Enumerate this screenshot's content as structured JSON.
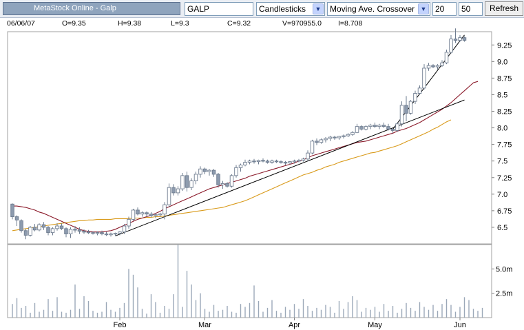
{
  "toolbar": {
    "title": "MetaStock Online - Galp",
    "symbol": "GALP",
    "chart_style": "Candlesticks",
    "indicator": "Moving Ave. Crossover",
    "period_fast": "20",
    "period_slow": "50",
    "refresh_label": "Refresh"
  },
  "info": {
    "date": "06/06/07",
    "open": "O=9.35",
    "high": "H=9.38",
    "low": "L=9.3",
    "close": "C=9.32",
    "volume": "V=970955.0",
    "interest": "I=8.708"
  },
  "colors": {
    "background": "#ffffff",
    "panel_border": "#a0a0a0",
    "candle_up": "#ffffff",
    "candle_down": "#8d9bae",
    "candle_outline": "#6e7c8f",
    "ma_fast": "#8b1a2a",
    "ma_slow": "#d99a1a",
    "trendline": "#000000",
    "volume_bar": "#9ba8b8"
  },
  "chart_data": {
    "type": "candlestick",
    "price_axis": {
      "ticks": [
        "9.25",
        "9.0",
        "8.75",
        "8.5",
        "8.25",
        "8.0",
        "7.75",
        "7.5",
        "7.25",
        "7.0",
        "6.75",
        "6.5"
      ],
      "ylim": [
        6.25,
        9.45
      ]
    },
    "volume_axis": {
      "ticks": [
        "5.0m",
        "2.5m"
      ],
      "ylim": [
        0,
        7500000
      ]
    },
    "x_labels": [
      "Feb",
      "Mar",
      "Apr",
      "May",
      "Jun"
    ],
    "x_label_days": [
      24,
      43,
      63,
      81,
      100
    ],
    "ohlc": [
      [
        6.85,
        6.86,
        6.62,
        6.66
      ],
      [
        6.66,
        6.68,
        6.52,
        6.61
      ],
      [
        6.6,
        6.62,
        6.42,
        6.45
      ],
      [
        6.45,
        6.48,
        6.32,
        6.38
      ],
      [
        6.38,
        6.52,
        6.36,
        6.5
      ],
      [
        6.5,
        6.55,
        6.44,
        6.46
      ],
      [
        6.46,
        6.56,
        6.44,
        6.54
      ],
      [
        6.54,
        6.58,
        6.46,
        6.5
      ],
      [
        6.5,
        6.52,
        6.38,
        6.42
      ],
      [
        6.42,
        6.5,
        6.38,
        6.48
      ],
      [
        6.48,
        6.56,
        6.45,
        6.52
      ],
      [
        6.52,
        6.56,
        6.46,
        6.48
      ],
      [
        6.48,
        6.5,
        6.35,
        6.4
      ],
      [
        6.4,
        6.5,
        6.34,
        6.47
      ],
      [
        6.47,
        6.52,
        6.42,
        6.46
      ],
      [
        6.46,
        6.5,
        6.4,
        6.44
      ],
      [
        6.44,
        6.47,
        6.4,
        6.43
      ],
      [
        6.43,
        6.46,
        6.4,
        6.42
      ],
      [
        6.42,
        6.44,
        6.39,
        6.41
      ],
      [
        6.41,
        6.44,
        6.38,
        6.42
      ],
      [
        6.42,
        6.45,
        6.38,
        6.4
      ],
      [
        6.4,
        6.43,
        6.37,
        6.39
      ],
      [
        6.39,
        6.42,
        6.36,
        6.4
      ],
      [
        6.4,
        6.42,
        6.37,
        6.41
      ],
      [
        6.41,
        6.44,
        6.38,
        6.43
      ],
      [
        6.43,
        6.55,
        6.4,
        6.52
      ],
      [
        6.52,
        6.66,
        6.48,
        6.62
      ],
      [
        6.62,
        6.78,
        6.6,
        6.76
      ],
      [
        6.76,
        6.8,
        6.68,
        6.7
      ],
      [
        6.7,
        6.74,
        6.66,
        6.72
      ],
      [
        6.72,
        6.74,
        6.66,
        6.7
      ],
      [
        6.7,
        6.73,
        6.65,
        6.68
      ],
      [
        6.68,
        6.71,
        6.64,
        6.69
      ],
      [
        6.69,
        6.72,
        6.66,
        6.7
      ],
      [
        6.7,
        6.88,
        6.62,
        6.84
      ],
      [
        6.84,
        7.16,
        6.8,
        7.1
      ],
      [
        7.1,
        7.15,
        6.98,
        7.02
      ],
      [
        7.02,
        7.12,
        6.98,
        7.08
      ],
      [
        7.08,
        7.32,
        7.05,
        7.28
      ],
      [
        7.28,
        7.34,
        7.04,
        7.1
      ],
      [
        7.1,
        7.24,
        7.06,
        7.2
      ],
      [
        7.2,
        7.34,
        7.15,
        7.3
      ],
      [
        7.3,
        7.42,
        7.25,
        7.38
      ],
      [
        7.38,
        7.4,
        7.3,
        7.34
      ],
      [
        7.34,
        7.38,
        7.28,
        7.36
      ],
      [
        7.36,
        7.38,
        7.26,
        7.3
      ],
      [
        7.3,
        7.32,
        7.1,
        7.14
      ],
      [
        7.14,
        7.2,
        7.08,
        7.16
      ],
      [
        7.16,
        7.18,
        7.1,
        7.12
      ],
      [
        7.12,
        7.3,
        7.1,
        7.28
      ],
      [
        7.28,
        7.44,
        7.25,
        7.4
      ],
      [
        7.4,
        7.46,
        7.34,
        7.44
      ],
      [
        7.44,
        7.52,
        7.42,
        7.48
      ],
      [
        7.48,
        7.52,
        7.45,
        7.5
      ],
      [
        7.5,
        7.53,
        7.46,
        7.49
      ],
      [
        7.49,
        7.52,
        7.45,
        7.51
      ],
      [
        7.51,
        7.54,
        7.48,
        7.5
      ],
      [
        7.5,
        7.52,
        7.46,
        7.48
      ],
      [
        7.48,
        7.52,
        7.46,
        7.5
      ],
      [
        7.5,
        7.52,
        7.47,
        7.49
      ],
      [
        7.49,
        7.51,
        7.46,
        7.48
      ],
      [
        7.48,
        7.5,
        7.44,
        7.47
      ],
      [
        7.47,
        7.5,
        7.45,
        7.49
      ],
      [
        7.49,
        7.52,
        7.46,
        7.5
      ],
      [
        7.5,
        7.53,
        7.48,
        7.51
      ],
      [
        7.51,
        7.55,
        7.49,
        7.53
      ],
      [
        7.53,
        7.66,
        7.5,
        7.62
      ],
      [
        7.62,
        7.82,
        7.6,
        7.8
      ],
      [
        7.8,
        7.84,
        7.74,
        7.78
      ],
      [
        7.78,
        7.84,
        7.76,
        7.82
      ],
      [
        7.82,
        7.86,
        7.78,
        7.84
      ],
      [
        7.84,
        7.88,
        7.8,
        7.86
      ],
      [
        7.86,
        7.88,
        7.82,
        7.85
      ],
      [
        7.85,
        7.88,
        7.82,
        7.87
      ],
      [
        7.87,
        7.9,
        7.84,
        7.88
      ],
      [
        7.88,
        7.92,
        7.86,
        7.9
      ],
      [
        7.9,
        7.95,
        7.88,
        7.93
      ],
      [
        7.93,
        8.06,
        7.92,
        8.02
      ],
      [
        8.02,
        8.04,
        7.96,
        7.98
      ],
      [
        7.98,
        8.04,
        7.96,
        8.02
      ],
      [
        8.02,
        8.06,
        7.98,
        8.04
      ],
      [
        8.04,
        8.08,
        8.0,
        8.02
      ],
      [
        8.02,
        8.06,
        7.98,
        8.04
      ],
      [
        8.04,
        8.08,
        8.0,
        8.02
      ],
      [
        8.02,
        8.06,
        7.96,
        7.98
      ],
      [
        7.98,
        8.0,
        7.92,
        7.96
      ],
      [
        7.96,
        8.08,
        7.94,
        8.06
      ],
      [
        8.06,
        8.4,
        8.02,
        8.34
      ],
      [
        8.34,
        8.48,
        8.1,
        8.22
      ],
      [
        8.22,
        8.42,
        8.2,
        8.4
      ],
      [
        8.4,
        8.56,
        8.36,
        8.52
      ],
      [
        8.52,
        8.64,
        8.5,
        8.6
      ],
      [
        8.6,
        8.96,
        8.58,
        8.9
      ],
      [
        8.9,
        8.98,
        8.86,
        8.94
      ],
      [
        8.94,
        8.96,
        8.9,
        8.92
      ],
      [
        8.92,
        8.96,
        8.88,
        8.94
      ],
      [
        8.94,
        9.02,
        8.92,
        8.98
      ],
      [
        8.98,
        9.18,
        8.96,
        9.14
      ],
      [
        9.14,
        9.4,
        9.12,
        9.34
      ],
      [
        9.34,
        9.5,
        9.28,
        9.32
      ],
      [
        9.32,
        9.4,
        9.3,
        9.36
      ],
      [
        9.36,
        9.38,
        9.3,
        9.32
      ]
    ],
    "volume": [
      1.4,
      2.0,
      1.0,
      1.2,
      0.5,
      1.5,
      0.6,
      0.8,
      1.9,
      0.7,
      2.1,
      0.6,
      0.5,
      0.8,
      3.4,
      0.9,
      2.2,
      1.7,
      0.7,
      0.5,
      0.6,
      1.6,
      0.8,
      0.6,
      1.0,
      1.5,
      5.0,
      4.4,
      3.1,
      0.9,
      0.4,
      2.4,
      1.6,
      0.5,
      1.2,
      0.9,
      2.4,
      7.5,
      1.1,
      4.8,
      3.4,
      1.8,
      2.5,
      0.9,
      0.6,
      1.3,
      0.7,
      0.8,
      1.2,
      0.6,
      0.5,
      1.4,
      1.1,
      1.5,
      3.3,
      1.7,
      0.6,
      1.0,
      1.8,
      0.7,
      0.5,
      1.1,
      0.8,
      1.4,
      0.9,
      1.9,
      1.2,
      0.7,
      1.0,
      0.8,
      1.3,
      1.1,
      0.5,
      1.7,
      0.9,
      1.6,
      2.2,
      1.8,
      0.6,
      1.0,
      0.8,
      1.1,
      0.6,
      1.4,
      0.7,
      1.2,
      0.5,
      0.9,
      1.5,
      1.0,
      0.7,
      1.6,
      1.1,
      0.8,
      1.3,
      0.7,
      1.4,
      1.9,
      1.3,
      0.6,
      1.1,
      2.1,
      1.8,
      0.9,
      0.7,
      1.0
    ],
    "ma_fast_values": [
      6.82,
      6.82,
      6.81,
      6.8,
      6.78,
      6.76,
      6.73,
      6.71,
      6.68,
      6.65,
      6.62,
      6.59,
      6.56,
      6.53,
      6.5,
      6.47,
      6.45,
      6.44,
      6.43,
      6.43,
      6.43,
      6.44,
      6.45,
      6.47,
      6.5,
      6.53,
      6.56,
      6.59,
      6.62,
      6.64,
      6.66,
      6.68,
      6.71,
      6.74,
      6.78,
      6.81,
      6.84,
      6.87,
      6.9,
      6.93,
      6.96,
      6.99,
      7.02,
      7.05,
      7.08,
      7.1,
      7.12,
      7.14,
      7.16,
      7.18,
      7.2,
      7.22,
      7.24,
      7.27,
      7.29,
      7.31,
      7.33,
      7.35,
      7.37,
      7.39,
      7.41,
      7.43,
      7.45,
      7.47,
      7.5,
      7.52,
      7.55,
      7.58,
      7.6,
      7.62,
      7.64,
      7.66,
      7.68,
      7.7,
      7.72,
      7.74,
      7.76,
      7.78,
      7.79,
      7.8,
      7.82,
      7.84,
      7.86,
      7.88,
      7.9,
      7.92,
      7.95,
      7.97,
      7.99,
      8.02,
      8.05,
      8.08,
      8.12,
      8.16,
      8.2,
      8.24,
      8.28,
      8.33,
      8.38,
      8.44,
      8.5,
      8.56,
      8.62,
      8.68,
      8.7
    ],
    "ma_slow_values": [
      6.45,
      6.46,
      6.47,
      6.48,
      6.49,
      6.5,
      6.51,
      6.52,
      6.53,
      6.54,
      6.55,
      6.56,
      6.57,
      6.58,
      6.59,
      6.6,
      6.6,
      6.61,
      6.61,
      6.62,
      6.62,
      6.62,
      6.62,
      6.63,
      6.63,
      6.63,
      6.63,
      6.64,
      6.64,
      6.64,
      6.65,
      6.65,
      6.66,
      6.66,
      6.67,
      6.68,
      6.69,
      6.7,
      6.71,
      6.72,
      6.73,
      6.74,
      6.75,
      6.76,
      6.77,
      6.78,
      6.79,
      6.8,
      6.82,
      6.84,
      6.86,
      6.88,
      6.9,
      6.93,
      6.96,
      6.99,
      7.02,
      7.05,
      7.08,
      7.11,
      7.14,
      7.17,
      7.2,
      7.23,
      7.26,
      7.29,
      7.31,
      7.33,
      7.36,
      7.38,
      7.41,
      7.43,
      7.45,
      7.48,
      7.5,
      7.52,
      7.54,
      7.56,
      7.58,
      7.6,
      7.62,
      7.63,
      7.65,
      7.67,
      7.69,
      7.71,
      7.73,
      7.76,
      7.79,
      7.82,
      7.85,
      7.88,
      7.91,
      7.94,
      7.98,
      8.01,
      8.05,
      8.09,
      8.12
    ],
    "trendlines": [
      {
        "from": [
          23,
          6.37
        ],
        "to": [
          101,
          8.42
        ]
      },
      {
        "from": [
          85,
          7.98
        ],
        "to": [
          101,
          9.4
        ]
      }
    ]
  }
}
